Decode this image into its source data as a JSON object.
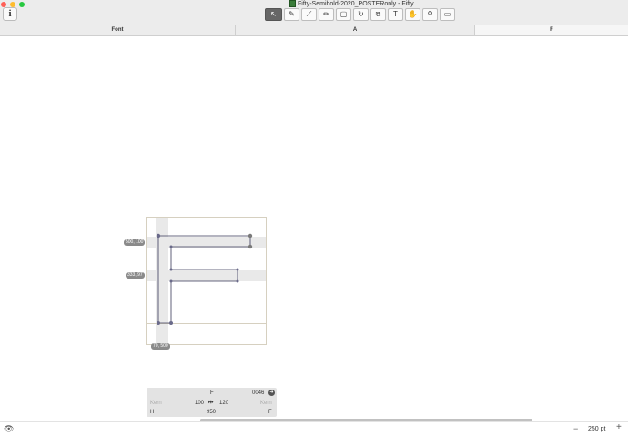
{
  "window": {
    "title": "Fifty-Semibold-2020_POSTERonly - Fifty",
    "info_label": "i"
  },
  "toolbar": {
    "tools": [
      {
        "icon": "pointer-icon",
        "glyph": "↖",
        "active": true
      },
      {
        "icon": "pen-icon",
        "glyph": "✎"
      },
      {
        "icon": "brush-icon",
        "glyph": "⟋"
      },
      {
        "icon": "pencil-icon",
        "glyph": "✏"
      },
      {
        "icon": "rectangle-icon",
        "glyph": "▢"
      },
      {
        "icon": "rotate-icon",
        "glyph": "↻"
      },
      {
        "icon": "scale-icon",
        "glyph": "⧉"
      },
      {
        "icon": "text-icon",
        "glyph": "T"
      },
      {
        "icon": "hand-icon",
        "glyph": "✋"
      },
      {
        "icon": "zoom-icon",
        "glyph": "⚲"
      },
      {
        "icon": "measure-icon",
        "glyph": "▭"
      }
    ]
  },
  "columns": {
    "font": "Font",
    "a": "A",
    "f": "F"
  },
  "canvas": {
    "coords": {
      "top": "500, 100",
      "mid": "333, 97",
      "bottom": "70, 500"
    }
  },
  "panel": {
    "glyph_name": "F",
    "unicode": "0046",
    "kern_left_label": "Kern",
    "kern_right_label": "Kern",
    "lsb": "100",
    "rsb": "120",
    "width": "950",
    "left_group": "H",
    "right_group": "F"
  },
  "status": {
    "zoom": "250 pt",
    "minus": "−",
    "plus": "+"
  },
  "colors": {
    "outline": "#3a3a5a",
    "node": "#6a6a8a",
    "band": "#e9e9e9"
  }
}
